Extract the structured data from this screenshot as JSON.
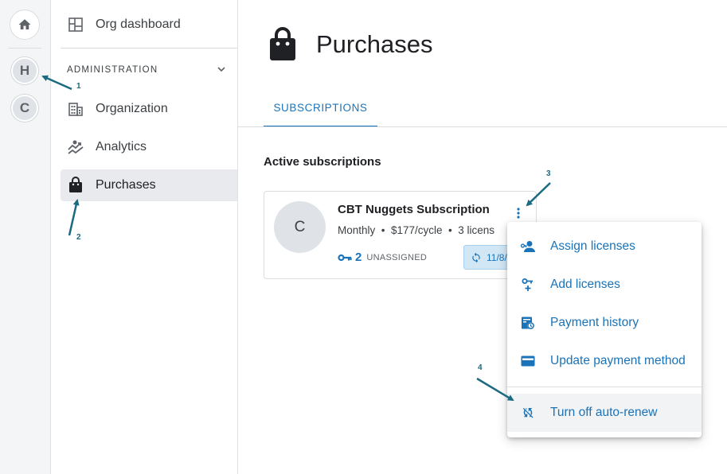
{
  "rail": {
    "home_icon": "home-icon",
    "accounts": [
      {
        "letter": "H"
      },
      {
        "letter": "C"
      }
    ]
  },
  "sidebar": {
    "org_dashboard_label": "Org dashboard",
    "section_header": "ADMINISTRATION",
    "items": [
      {
        "label": "Organization",
        "icon": "building-icon"
      },
      {
        "label": "Analytics",
        "icon": "analytics-icon"
      },
      {
        "label": "Purchases",
        "icon": "shopping-bag-icon",
        "active": true
      }
    ]
  },
  "main": {
    "page_title": "Purchases",
    "tabs": [
      {
        "label": "SUBSCRIPTIONS",
        "selected": true
      }
    ],
    "section_title": "Active subscriptions",
    "subscription": {
      "avatar_letter": "C",
      "name": "CBT Nuggets Subscription",
      "meta": "Monthly  •  $177/cycle  •  3 licens",
      "unassigned_count": "2",
      "unassigned_label": "UNASSIGNED",
      "renew_date": "11/8/"
    }
  },
  "menu": {
    "items": [
      {
        "label": "Assign licenses",
        "icon": "assign-user-icon"
      },
      {
        "label": "Add licenses",
        "icon": "add-key-icon"
      },
      {
        "label": "Payment history",
        "icon": "payment-history-icon"
      },
      {
        "label": "Update payment method",
        "icon": "credit-card-icon"
      },
      {
        "label": "Turn off auto-renew",
        "icon": "sync-disabled-icon",
        "highlighted": true
      }
    ]
  },
  "annotations": [
    {
      "number": "1"
    },
    {
      "number": "2"
    },
    {
      "number": "3"
    },
    {
      "number": "4"
    }
  ],
  "colors": {
    "accent": "#1a73b8",
    "annotation_arrow": "#1b6a82",
    "active_nav_bg": "#e8eaed"
  }
}
